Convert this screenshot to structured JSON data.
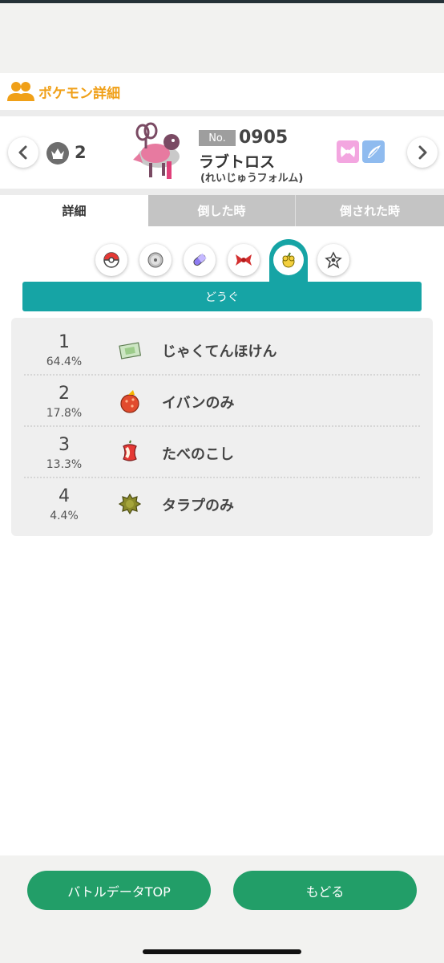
{
  "header": {
    "title": "ポケモン詳細"
  },
  "pokemon": {
    "rank": "2",
    "no_label": "No.",
    "number": "0905",
    "name": "ラブトロス",
    "form": "(れいじゅうフォルム)",
    "types": [
      "fairy-type-icon",
      "flying-type-icon"
    ]
  },
  "tabs": [
    {
      "label": "詳細",
      "active": true
    },
    {
      "label": "倒した時",
      "active": false
    },
    {
      "label": "倒された時",
      "active": false
    }
  ],
  "categories": [
    {
      "icon": "pokeball-icon",
      "active": false
    },
    {
      "icon": "disc-icon",
      "active": false
    },
    {
      "icon": "capsule-icon",
      "active": false
    },
    {
      "icon": "ribbon-icon",
      "active": false
    },
    {
      "icon": "item-icon",
      "active": true
    },
    {
      "icon": "tera-icon",
      "active": false
    }
  ],
  "category_label": "どうぐ",
  "items": [
    {
      "rank": "1",
      "percent": "64.4%",
      "name": "じゃくてんほけん",
      "icon": "weakness-policy-icon"
    },
    {
      "rank": "2",
      "percent": "17.8%",
      "name": "イバンのみ",
      "icon": "custap-berry-icon"
    },
    {
      "rank": "3",
      "percent": "13.3%",
      "name": "たべのこし",
      "icon": "leftovers-icon"
    },
    {
      "rank": "4",
      "percent": "4.4%",
      "name": "タラプのみ",
      "icon": "maranga-berry-icon"
    }
  ],
  "footer": {
    "top_button": "バトルデータTOP",
    "back_button": "もどる"
  },
  "colors": {
    "accent_orange": "#f0a018",
    "teal": "#16a4a5",
    "green_button": "#229e68"
  }
}
